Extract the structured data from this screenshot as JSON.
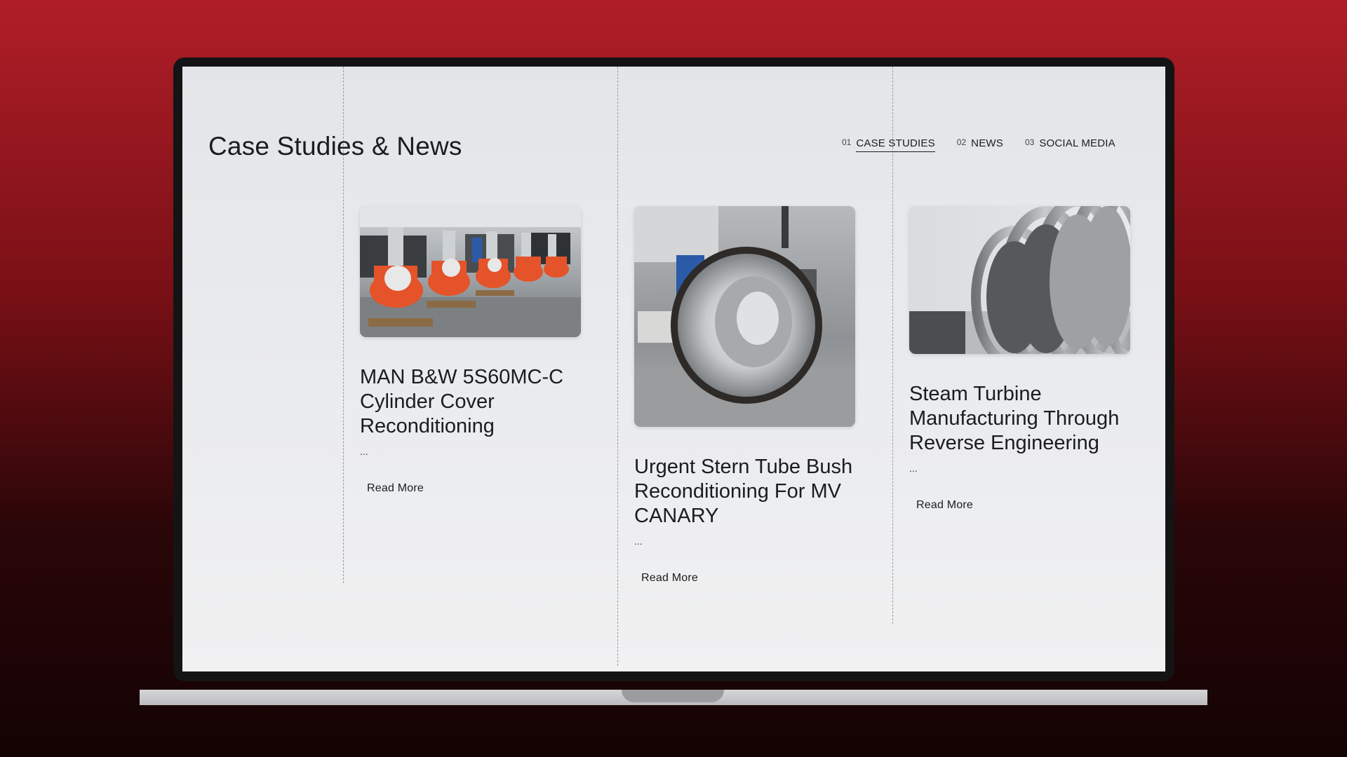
{
  "page": {
    "title": "Case Studies & News"
  },
  "tabs": [
    {
      "number": "01",
      "label": "CASE STUDIES",
      "active": true
    },
    {
      "number": "02",
      "label": "NEWS",
      "active": false
    },
    {
      "number": "03",
      "label": "SOCIAL MEDIA",
      "active": false
    }
  ],
  "cards": [
    {
      "title": "MAN B&W 5S60MC-C Cylinder Cover Reconditioning",
      "ellipsis": "...",
      "read_more": "Read More",
      "image_icon": "cylinder-covers-photo"
    },
    {
      "title": "Urgent Stern Tube Bush Reconditioning For MV CANARY",
      "ellipsis": "...",
      "read_more": "Read More",
      "image_icon": "stern-tube-bush-photo"
    },
    {
      "title": "Steam Turbine Manufacturing Through Reverse Engineering",
      "ellipsis": "...",
      "read_more": "Read More",
      "image_icon": "steam-turbine-photo"
    }
  ],
  "colors": {
    "background_top": "#b01e28",
    "background_bottom": "#140304",
    "screen": "#e8e9eb",
    "text": "#1b1c1e",
    "accent_orange": "#e4532a"
  }
}
